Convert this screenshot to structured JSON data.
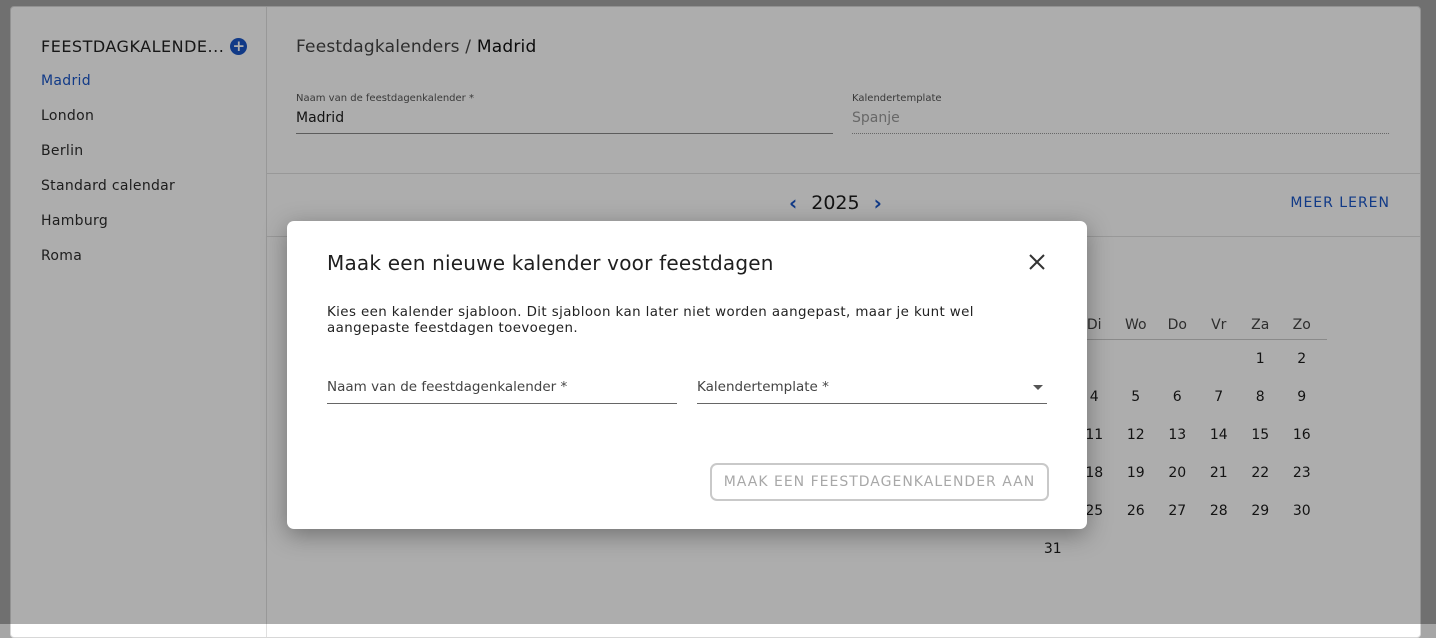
{
  "sidebar": {
    "title": "FEESTDAGKALENDE...",
    "add_icon": "plus-circle-icon",
    "items": [
      "Madrid",
      "London",
      "Berlin",
      "Standard calendar",
      "Hamburg",
      "Roma"
    ],
    "active_index": 0
  },
  "main": {
    "breadcrumb_parent": "Feestdagkalenders /",
    "breadcrumb_current": "Madrid",
    "name_label": "Naam van de feestdagenkalender *",
    "name_value": "Madrid",
    "template_label": "Kalendertemplate",
    "template_value": "Spanje",
    "year": "2025",
    "learn_more": "MEER LEREN",
    "weekdays": [
      "Di",
      "Wo",
      "Do",
      "Vr",
      "Za",
      "Zo"
    ],
    "calendar_rows": [
      [
        "",
        "",
        "",
        "",
        "",
        "1",
        "2"
      ],
      [
        "",
        "4",
        "5",
        "6",
        "7",
        "8",
        "9"
      ],
      [
        "",
        "11",
        "12",
        "13",
        "14",
        "15",
        "16"
      ],
      [
        "",
        "18",
        "19",
        "20",
        "21",
        "22",
        "23"
      ],
      [
        "",
        "25",
        "26",
        "27",
        "28",
        "29",
        "30"
      ],
      [
        "31",
        "",
        "",
        "",
        "",
        "",
        ""
      ]
    ]
  },
  "modal": {
    "title": "Maak een nieuwe kalender voor feestdagen",
    "description": "Kies een kalender sjabloon. Dit sjabloon kan later niet worden aangepast, maar je kunt wel aangepaste feestdagen toevoegen.",
    "name_placeholder": "Naam van de feestdagenkalender *",
    "template_placeholder": "Kalendertemplate *",
    "submit_label": "MAAK EEN FEESTDAGENKALENDER AAN"
  },
  "colors": {
    "accent": "#1a56c8",
    "overlay": "rgba(0,0,0,0.32)"
  }
}
